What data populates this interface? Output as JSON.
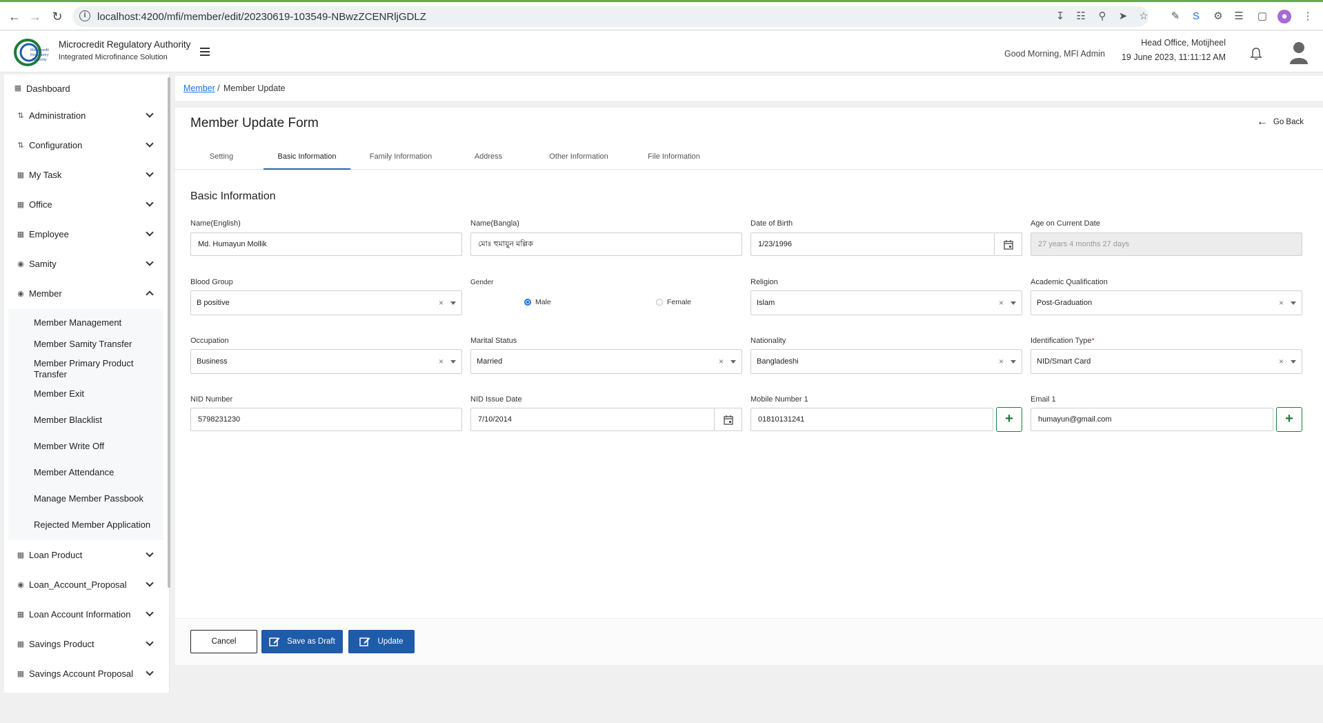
{
  "browser": {
    "url": "localhost:4200/mfi/member/edit/20230619-103549-NBwzZCENRljGDLZ"
  },
  "header": {
    "org_name": "Microcredit Regulatory Authority",
    "app_name": "Integrated Microfinance Solution",
    "logo_text": "Microcredit Regulatory Authority",
    "greeting": "Good Morning, MFI Admin",
    "office": "Head Office, Motijheel",
    "datetime": "19 June 2023, 11:11:12 AM"
  },
  "sidebar": {
    "dashboard": "Dashboard",
    "items": [
      {
        "label": "Administration",
        "icon": "sliders-icon"
      },
      {
        "label": "Configuration",
        "icon": "sliders-icon"
      },
      {
        "label": "My Task",
        "icon": "task-icon"
      },
      {
        "label": "Office",
        "icon": "building-icon"
      },
      {
        "label": "Employee",
        "icon": "id-card-icon"
      },
      {
        "label": "Samity",
        "icon": "group-icon"
      },
      {
        "label": "Member",
        "icon": "members-icon"
      }
    ],
    "member_submenu": [
      "Member Management",
      "Member Samity Transfer",
      "Member Primary Product Transfer",
      "Member Exit",
      "Member Blacklist",
      "Member Write Off",
      "Member Attendance",
      "Manage Member Passbook",
      "Rejected Member Application"
    ],
    "items_after": [
      {
        "label": "Loan Product",
        "icon": "document-icon"
      },
      {
        "label": "Loan_Account_Proposal",
        "icon": "members-icon"
      },
      {
        "label": "Loan Account Information",
        "icon": "document-icon"
      },
      {
        "label": "Savings Product",
        "icon": "document-icon"
      },
      {
        "label": "Savings Account Proposal",
        "icon": "document-icon"
      }
    ]
  },
  "breadcrumb": {
    "link": "Member",
    "separator": "/",
    "current": "Member Update"
  },
  "form": {
    "title": "Member Update Form",
    "go_back": "Go Back",
    "tabs": [
      "Setting",
      "Basic Information",
      "Family Information",
      "Address",
      "Other Information",
      "File Information"
    ],
    "active_tab": "Basic Information",
    "section_title": "Basic Information",
    "fields": {
      "name_english": {
        "label": "Name(English)",
        "value": "Md. Humayun Mollik"
      },
      "name_bangla": {
        "label": "Name(Bangla)",
        "value": "মোঃ হুমায়ুন মল্লিক"
      },
      "dob": {
        "label": "Date of Birth",
        "value": "1/23/1996"
      },
      "age": {
        "label": "Age on Current Date",
        "value": "27 years 4 months 27 days"
      },
      "blood_group": {
        "label": "Blood Group",
        "value": "B positive"
      },
      "gender": {
        "label": "Gender",
        "options": [
          "Male",
          "Female"
        ],
        "selected": "Male"
      },
      "religion": {
        "label": "Religion",
        "value": "Islam"
      },
      "academic": {
        "label": "Academic Qualification",
        "value": "Post-Graduation"
      },
      "occupation": {
        "label": "Occupation",
        "value": "Business"
      },
      "marital": {
        "label": "Marital Status",
        "value": "Married"
      },
      "nationality": {
        "label": "Nationality",
        "value": "Bangladeshi"
      },
      "id_type": {
        "label": "Identification Type",
        "required_mark": "*",
        "value": "NID/Smart Card"
      },
      "nid_number": {
        "label": "NID Number",
        "value": "5798231230"
      },
      "nid_issue": {
        "label": "NID Issue Date",
        "value": "7/10/2014"
      },
      "mobile": {
        "label": "Mobile Number 1",
        "value": "01810131241"
      },
      "email": {
        "label": "Email 1",
        "value": "humayun@gmail.com"
      }
    }
  },
  "actions": {
    "cancel": "Cancel",
    "save_draft": "Save as Draft",
    "update": "Update"
  },
  "colors": {
    "primary": "#1e5ba8",
    "green": "#1f7a3a",
    "link": "#1a73e8"
  }
}
